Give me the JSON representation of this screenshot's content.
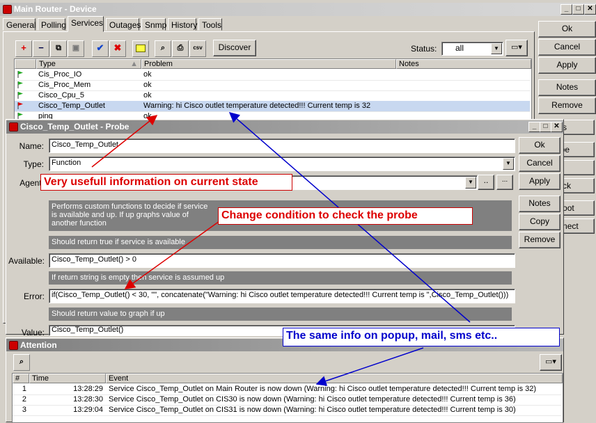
{
  "main_window": {
    "title": "Main Router - Device",
    "tabs": [
      "General",
      "Polling",
      "Services",
      "Outages",
      "Snmp",
      "History",
      "Tools"
    ],
    "active_tab": "Services",
    "discover_label": "Discover",
    "status_label": "Status:",
    "status_value": "all",
    "columns": {
      "type": "Type",
      "problem": "Problem",
      "notes": "Notes"
    },
    "rows": [
      {
        "type": "Cis_Proc_IO",
        "problem": "ok",
        "flag": "#2a2"
      },
      {
        "type": "Cis_Proc_Mem",
        "problem": "ok",
        "flag": "#2a2"
      },
      {
        "type": "Cisco_Cpu_5",
        "problem": "ok",
        "flag": "#2a2"
      },
      {
        "type": "Cisco_Temp_Outlet",
        "problem": "Warning: hi Cisco outlet temperature detected!!! Current temp is 32",
        "flag": "#d00"
      },
      {
        "type": "ping",
        "problem": "ok",
        "flag": "#2a2"
      }
    ],
    "side_buttons": [
      "Ok",
      "Cancel",
      "Apply",
      "Notes",
      "Remove"
    ],
    "side_buttons_partial": [
      "Tools",
      "Probe",
      "Ack",
      "Unack",
      "Reboot",
      "Connect"
    ]
  },
  "probe_window": {
    "title": "Cisco_Temp_Outlet - Probe",
    "name_label": "Name:",
    "name_value": "Cisco_Temp_Outlet",
    "type_label": "Type:",
    "type_value": "Function",
    "agent_label": "Agent:",
    "agent_browse": "..",
    "agent_more": "...",
    "desc_text": "Performs custom functions to decide if service is available and up. If up graphs value of another function",
    "available_hint": "Should return true if service is available",
    "available_label": "Available:",
    "available_value": "Cisco_Temp_Outlet() > 0",
    "error_hint": "If return string is empty then service is assumed up",
    "error_label": "Error:",
    "error_value": "if(Cisco_Temp_Outlet() < 30, \"\", concatenate(\"Warning: hi Cisco outlet temperature detected!!! Current temp is \",Cisco_Temp_Outlet()))",
    "value_hint": "Should return value to graph if up",
    "value_label": "Value:",
    "value_value": "Cisco_Temp_Outlet()",
    "buttons": [
      "Ok",
      "Cancel",
      "Apply",
      "Notes",
      "Copy",
      "Remove"
    ]
  },
  "attention_window": {
    "title": "Attention",
    "columns": {
      "num": "#",
      "time": "Time",
      "event": "Event"
    },
    "rows": [
      {
        "num": "1",
        "time": "13:28:29",
        "event": "Service Cisco_Temp_Outlet on Main Router is now down (Warning: hi Cisco outlet temperature detected!!! Current temp is 32)"
      },
      {
        "num": "2",
        "time": "13:28:30",
        "event": "Service Cisco_Temp_Outlet on CIS30 is now down (Warning: hi Cisco outlet temperature detected!!! Current temp is 36)"
      },
      {
        "num": "3",
        "time": "13:29:04",
        "event": "Service Cisco_Temp_Outlet on CIS31 is now down (Warning: hi Cisco outlet temperature detected!!! Current temp is 30)"
      }
    ]
  },
  "annotations": {
    "current_state": "Very usefull information on current state",
    "change_condition": "Change condition to check the probe",
    "same_info": "The same info on popup, mail, sms etc.."
  }
}
